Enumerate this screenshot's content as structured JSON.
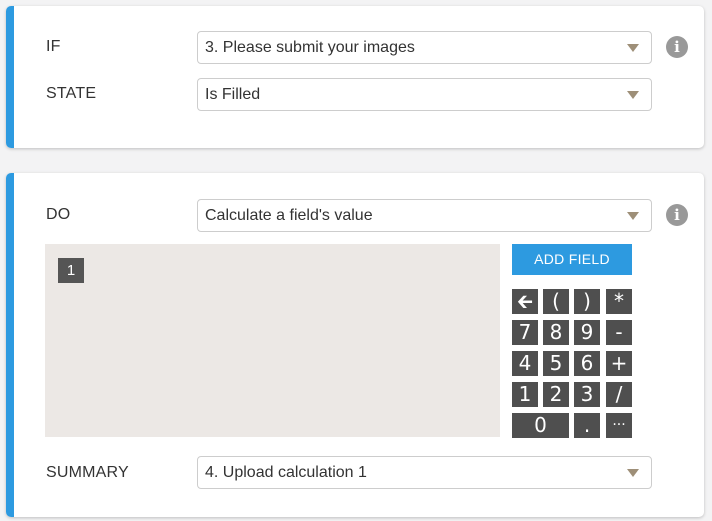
{
  "colors": {
    "accent": "#2d9ae0",
    "key_bg": "#4f4f4f",
    "calc_bg": "#ece8e5"
  },
  "condition": {
    "if_label": "IF",
    "if_value": "3. Please submit your images",
    "state_label": "STATE",
    "state_value": "Is Filled",
    "info_icon": "i"
  },
  "action": {
    "do_label": "DO",
    "do_value": "Calculate a field's value",
    "info_icon": "i",
    "line_number": "1",
    "add_field_label": "ADD FIELD",
    "keypad": {
      "backspace": "🡰",
      "open_paren": "(",
      "close_paren": ")",
      "multiply": "*",
      "k7": "7",
      "k8": "8",
      "k9": "9",
      "minus": "-",
      "k4": "4",
      "k5": "5",
      "k6": "6",
      "plus": "+",
      "k1": "1",
      "k2": "2",
      "k3": "3",
      "divide": "/",
      "k0": "0",
      "dot": ".",
      "more": "···"
    },
    "summary_label": "SUMMARY",
    "summary_value": "4. Upload calculation 1"
  }
}
